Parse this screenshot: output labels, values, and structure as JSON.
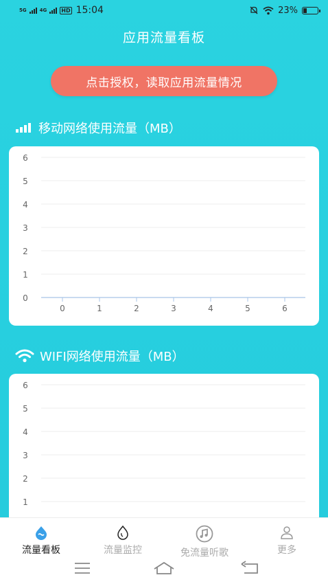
{
  "status_bar": {
    "net1": "5G",
    "net2": "4G",
    "hd": "HD",
    "time": "15:04",
    "battery": "23%",
    "icons": [
      "mute-icon",
      "wifi-icon",
      "battery-icon"
    ]
  },
  "header": {
    "title": "应用流量看板"
  },
  "auth_button": {
    "label": "点击授权，读取应用流量情况",
    "color": "#f07465"
  },
  "mobile_section": {
    "title": "移动网络使用流量（MB）",
    "icon": "signal-bars-icon"
  },
  "wifi_section": {
    "title": "WIFI网络使用流量（MB）",
    "icon": "wifi-icon"
  },
  "chart_data": [
    {
      "type": "line",
      "x": [
        0,
        1,
        2,
        3,
        4,
        5,
        6
      ],
      "y_ticks": [
        0,
        1,
        2,
        3,
        4,
        5,
        6
      ],
      "ylim": [
        0,
        6
      ],
      "series": [],
      "grid": true
    },
    {
      "type": "line",
      "y_ticks": [
        1,
        2,
        3,
        4,
        5,
        6
      ],
      "ylim": [
        0,
        6
      ],
      "series": [],
      "grid": true
    }
  ],
  "tabs": [
    {
      "label": "流量看板",
      "icon": "dashboard-icon",
      "active": true
    },
    {
      "label": "流量监控",
      "icon": "water-drop-icon",
      "active": false
    },
    {
      "label": "免流量听歌",
      "icon": "music-note-icon",
      "active": false
    },
    {
      "label": "更多",
      "icon": "user-icon",
      "active": false
    }
  ],
  "colors": {
    "background": "#27cfdf",
    "accent": "#f07465",
    "active_tab_icon": "#3aa0e8",
    "axis": "#a8c4e8"
  }
}
